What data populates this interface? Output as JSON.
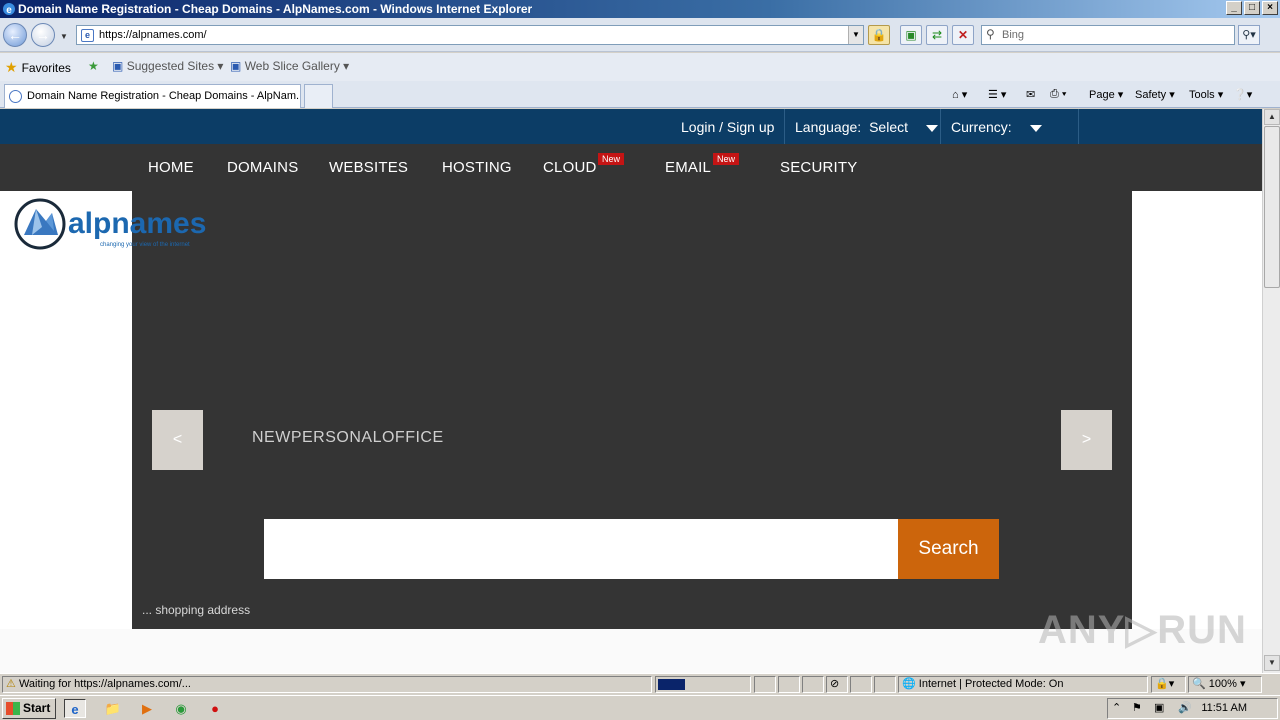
{
  "window": {
    "title": "Domain Name Registration - Cheap Domains - AlpNames.com - Windows Internet Explorer",
    "buttons": [
      "_",
      "□",
      "×"
    ]
  },
  "address_bar": {
    "url": "https://alpnames.com/",
    "search_placeholder": "Bing"
  },
  "favorites_bar": {
    "favorites_label": "Favorites",
    "suggested_sites": "Suggested Sites",
    "web_slice_gallery": "Web Slice Gallery"
  },
  "tab": {
    "title": "Domain Name Registration - Cheap Domains - AlpNam..."
  },
  "command_bar": {
    "page": "Page",
    "safety": "Safety",
    "tools": "Tools"
  },
  "site": {
    "topbar": {
      "login": "Login / Sign up",
      "language_label": "Language:",
      "language_value": "Select",
      "currency_label": "Currency:"
    },
    "nav": [
      {
        "label": "HOME",
        "badge": ""
      },
      {
        "label": "DOMAINS",
        "badge": ""
      },
      {
        "label": "WEBSITES",
        "badge": ""
      },
      {
        "label": "HOSTING",
        "badge": ""
      },
      {
        "label": "CLOUD",
        "badge": "New"
      },
      {
        "label": "EMAIL",
        "badge": "New"
      },
      {
        "label": "SECURITY",
        "badge": ""
      }
    ],
    "logo": {
      "brand": "alpnames",
      "tagline": "changing your view of the internet"
    },
    "slider": {
      "prev": "<",
      "next": ">",
      "text": "NEWPERSONALOFFICE"
    },
    "search": {
      "button": "Search",
      "value": ""
    },
    "ticker": "... shopping address"
  },
  "status_bar": {
    "status": "Waiting for https://alpnames.com/...",
    "zone": "Internet | Protected Mode: On",
    "zoom": "100%",
    "progress": 0.1
  },
  "taskbar": {
    "start": "Start",
    "time": "11:51 AM"
  },
  "colors": {
    "topbar": "#0c3d66",
    "navbar": "#343434",
    "search_button": "#cc650c",
    "new_badge": "#c41414"
  }
}
